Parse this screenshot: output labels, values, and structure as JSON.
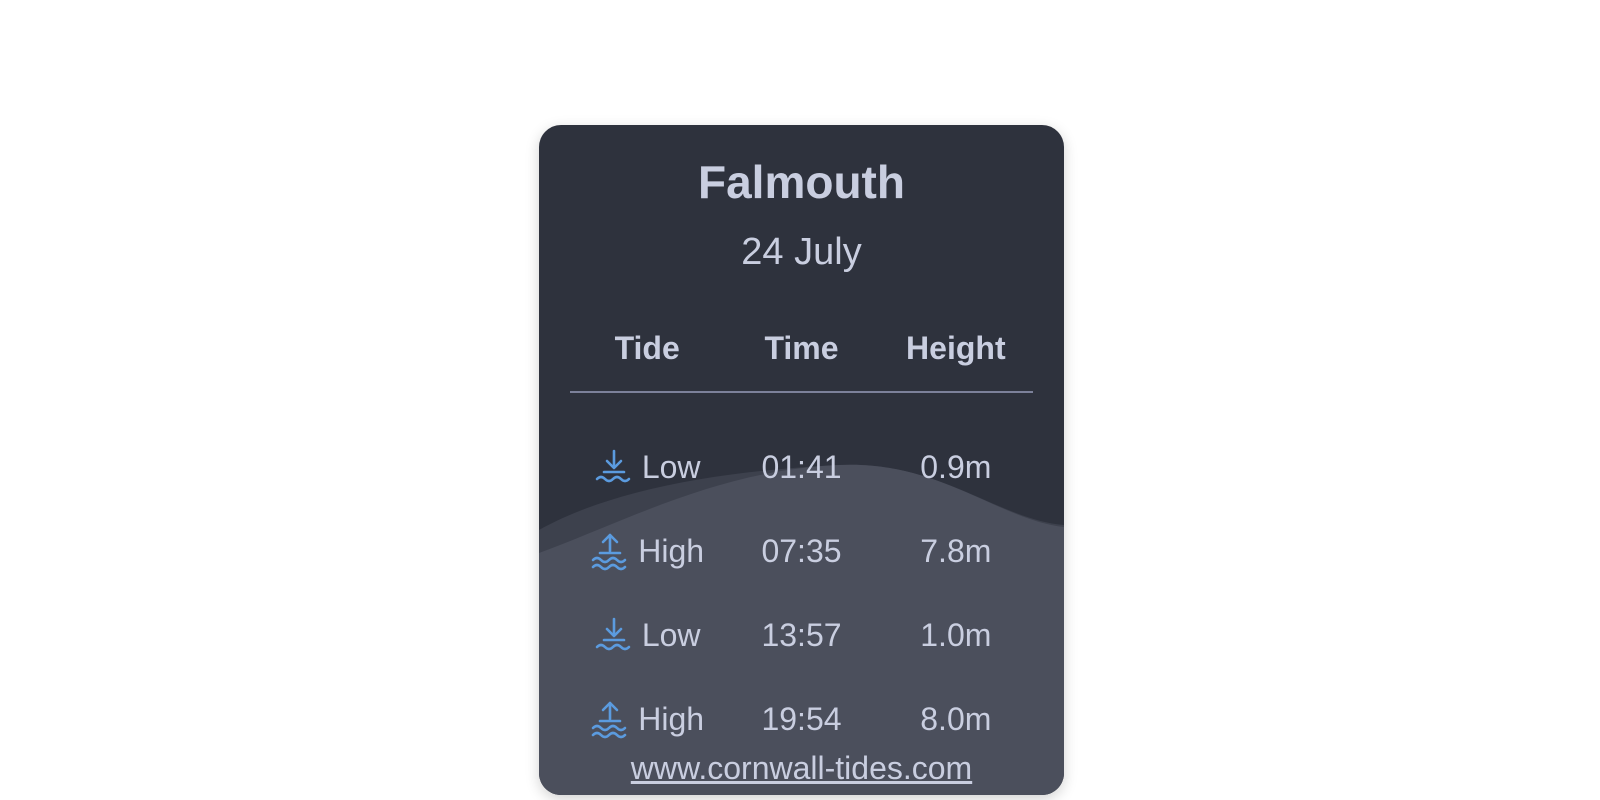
{
  "card": {
    "location": "Falmouth",
    "date": "24 July",
    "headers": {
      "tide": "Tide",
      "time": "Time",
      "height": "Height"
    },
    "rows": [
      {
        "tide": "Low",
        "time": "01:41",
        "height": "0.9m",
        "icon": "low-tide-icon"
      },
      {
        "tide": "High",
        "time": "07:35",
        "height": "7.8m",
        "icon": "high-tide-icon"
      },
      {
        "tide": "Low",
        "time": "13:57",
        "height": "1.0m",
        "icon": "low-tide-icon"
      },
      {
        "tide": "High",
        "time": "19:54",
        "height": "8.0m",
        "icon": "high-tide-icon"
      }
    ],
    "link": "www.cornwall-tides.com"
  },
  "colors": {
    "card_bg": "#2e323d",
    "wave": "#4b4f5c",
    "text": "#c9cee0",
    "icon": "#5b9bdf"
  }
}
